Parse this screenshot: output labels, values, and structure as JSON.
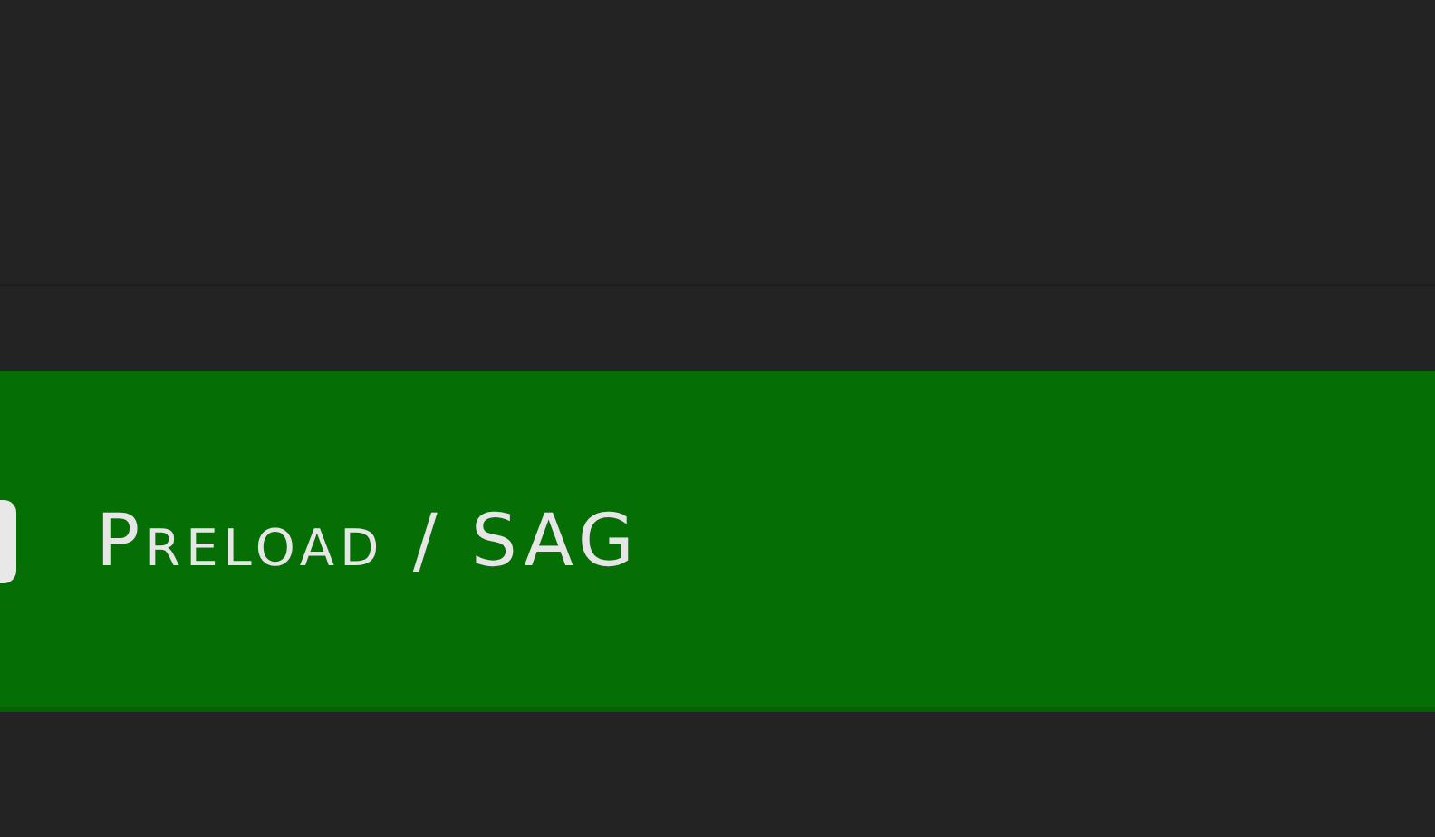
{
  "banner": {
    "title": "Preload / SAG"
  }
}
